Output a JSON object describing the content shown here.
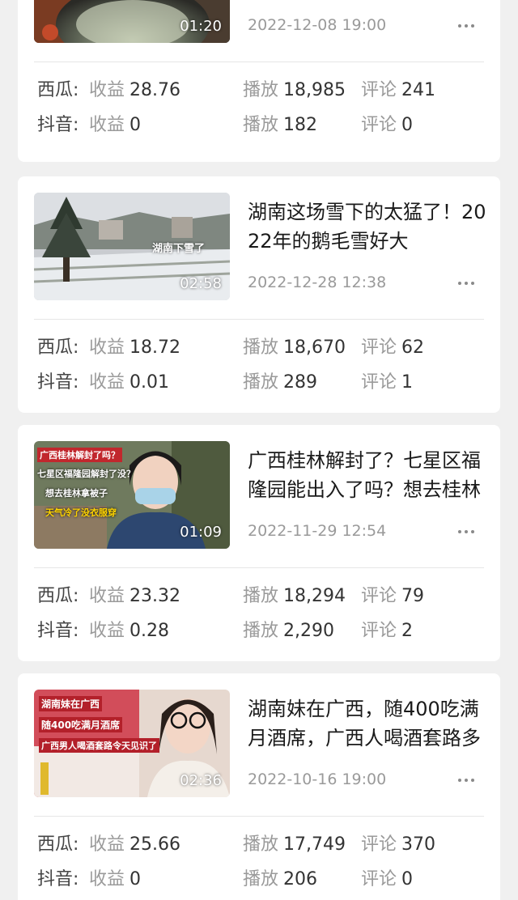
{
  "stat_labels": {
    "revenue": "收益",
    "plays": "播放",
    "comments": "评论"
  },
  "cards": [
    {
      "duration": "01:20",
      "title": "",
      "date": "2022-12-08 19:00",
      "thumb_icon": "hotpot-thumbnail",
      "stats": [
        {
          "platform": "西瓜",
          "revenue": "28.76",
          "plays": "18,985",
          "comments": "241"
        },
        {
          "platform": "抖音",
          "revenue": "0",
          "plays": "182",
          "comments": "0"
        }
      ]
    },
    {
      "duration": "02:58",
      "title": "湖南这场雪下的太猛了！2022年的鹅毛雪好大",
      "date": "2022-12-28 12:38",
      "thumb_caption": "湖南下雪了",
      "thumb_icon": "snow-village-thumbnail",
      "stats": [
        {
          "platform": "西瓜",
          "revenue": "18.72",
          "plays": "18,670",
          "comments": "62"
        },
        {
          "platform": "抖音",
          "revenue": "0.01",
          "plays": "289",
          "comments": "1"
        }
      ]
    },
    {
      "duration": "01:09",
      "title": "广西桂林解封了？七星区福隆园能出入了吗？想去桂林",
      "date": "2022-11-29 12:54",
      "thumb_captions": [
        "广西桂林解封了吗？",
        "七星区福隆园解封了没？",
        "想去桂林拿被子",
        "天气冷了没衣服穿"
      ],
      "thumb_icon": "masked-woman-thumbnail",
      "stats": [
        {
          "platform": "西瓜",
          "revenue": "23.32",
          "plays": "18,294",
          "comments": "79"
        },
        {
          "platform": "抖音",
          "revenue": "0.28",
          "plays": "2,290",
          "comments": "2"
        }
      ]
    },
    {
      "duration": "02:36",
      "title": "湖南妹在广西，随400吃满月酒席，广西人喝酒套路多",
      "date": "2022-10-16 19:00",
      "thumb_captions": [
        "湖南妹在广西",
        "随400吃满月酒席",
        "广西男人喝酒套路令天见识了"
      ],
      "thumb_icon": "glasses-woman-thumbnail",
      "stats": [
        {
          "platform": "西瓜",
          "revenue": "25.66",
          "plays": "17,749",
          "comments": "370"
        },
        {
          "platform": "抖音",
          "revenue": "0",
          "plays": "206",
          "comments": "0"
        }
      ]
    }
  ]
}
